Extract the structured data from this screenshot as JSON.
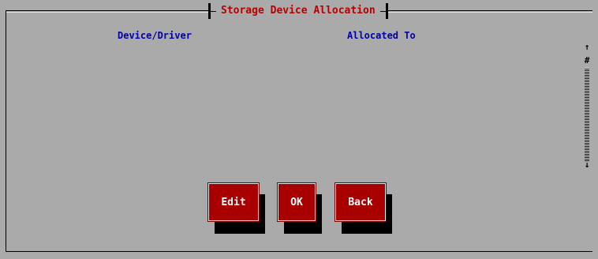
{
  "dialog": {
    "title": "Storage Device Allocation"
  },
  "columns": {
    "device": "Device/Driver",
    "allocated": "Allocated To"
  },
  "scrollbar": {
    "up_glyph": "↑",
    "thumb_glyph": "#",
    "down_glyph": "↓"
  },
  "buttons": {
    "edit": "Edit",
    "ok": "OK",
    "back": "Back"
  },
  "colors": {
    "background": "#aaaaaa",
    "title_text": "#b80000",
    "header_text": "#0000a8",
    "button_fill": "#a80000",
    "button_text": "#ffffff"
  }
}
